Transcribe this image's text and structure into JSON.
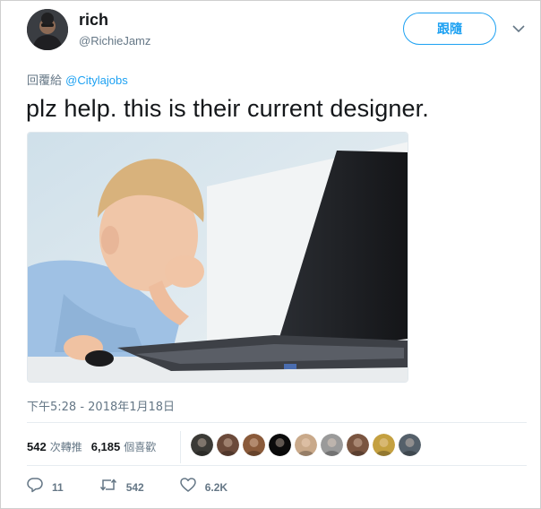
{
  "user": {
    "display_name": "rich",
    "handle": "@RichieJamz"
  },
  "follow_button": {
    "label": "跟隨"
  },
  "reply_to": {
    "prefix": "回覆給 ",
    "mention": "@Citylajobs"
  },
  "tweet": {
    "text": "plz help. this is their current designer."
  },
  "timestamp": "下午5:28 - 2018年1月18日",
  "stats": {
    "retweets": {
      "count": "542",
      "label": "次轉推"
    },
    "likes": {
      "count": "6,185",
      "label": "個喜歡"
    }
  },
  "likers": [
    {
      "color": "#3b3a36"
    },
    {
      "color": "#6b4a3a"
    },
    {
      "color": "#8a5a3a"
    },
    {
      "color": "#0b0b0b"
    },
    {
      "color": "#c9a98a"
    },
    {
      "color": "#9a9a9a"
    },
    {
      "color": "#7a5540"
    },
    {
      "color": "#c4a040"
    },
    {
      "color": "#55606a"
    }
  ],
  "actions": {
    "reply": {
      "icon": "reply-icon",
      "count": "11"
    },
    "retweet": {
      "icon": "retweet-icon",
      "count": "542"
    },
    "like": {
      "icon": "heart-icon",
      "count": "6.2K"
    }
  },
  "colors": {
    "accent": "#1da1f2",
    "muted": "#657786",
    "text": "#14171a"
  }
}
